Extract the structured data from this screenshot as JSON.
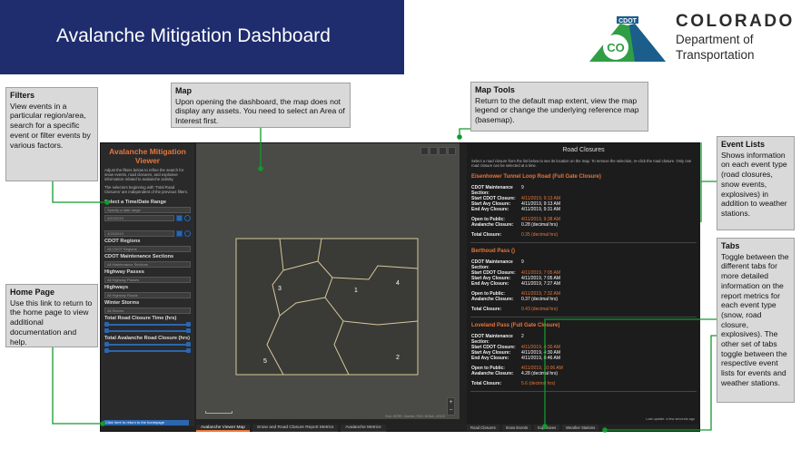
{
  "banner_title": "Avalanche Mitigation Dashboard",
  "logo": {
    "badge": "CDOT",
    "monogram": "CO",
    "state": "COLORADO",
    "dept_line1": "Department of",
    "dept_line2": "Transportation"
  },
  "callouts": {
    "filters": {
      "title": "Filters",
      "body": "View events in a particular region/area, search for a specific event or filter events by various factors."
    },
    "map": {
      "title": "Map",
      "body": "Upon opening the dashboard, the map does not display any assets. You need to select an Area of Interest first."
    },
    "map_tools": {
      "title": "Map Tools",
      "body": "Return to the default map extent, view the map legend or change the underlying reference map (basemap)."
    },
    "event_lists": {
      "title": "Event Lists",
      "body": "Shows information on each event type (road closures, snow events, explosives) in addition to weather stations."
    },
    "tabs": {
      "title": "Tabs",
      "body": "Toggle between the different tabs for more detailed information on the report metrics for each event type (snow, road closure, explosives). The other set of tabs toggle between the respective event lists for events and weather stations."
    },
    "home_page": {
      "title": "Home Page",
      "body": "Use this link to return to the home page to view additional documentation and help."
    }
  },
  "sidebar": {
    "title": "Avalanche Mitigation Viewer",
    "intro": "Adjust the filters below to refine the search for snow events, road closures, and explosive information related to avalanche activity.",
    "note": "The selectors beginning with 'Total Road Closures' are independent of the previous filters.",
    "time_head": "Select a Time/Date Range",
    "time_select": "Specify a date range",
    "date_start": "4/10/2019",
    "date_end": "4/23/2019",
    "regions_head": "CDOT Regions",
    "regions_select": "All CDOT Regions",
    "maint_head": "CDOT Maintenance Sections",
    "maint_select": "All Maintenance Sections",
    "passes_head": "Highway Passes",
    "passes_select": "All Highway Passes",
    "highways_head": "Highways",
    "highways_select": "All Highway Roads",
    "storms_head": "Winter Storms",
    "storms_select": "All Storms",
    "closure_time_head": "Total Road Closure Time (hrs)",
    "closure_avalanche_head": "Total Avalanche Road Closure (hrs)",
    "home_link": "Click here to return to the homepage"
  },
  "map": {
    "region_labels": [
      "1",
      "2",
      "3",
      "4",
      "5"
    ],
    "attribution": "Esri, HERE, Garmin, FAO, NOAA, USGS"
  },
  "panel": {
    "title": "Road Closures",
    "instructions": "Select a road closure from the list below to see its location on the map. To remove the selection, re-click the road closure. Only one road closure can be selected at a time.",
    "events": [
      {
        "name": "Eisenhower Tunnel Loop Road (Full Gate Closure)",
        "section": "9",
        "start_cdot": "4/11/2019, 9:13 AM",
        "start_avy": "4/11/2019, 9:13 AM",
        "end_avy": "4/11/2019, 9:31 AM",
        "open": "4/11/2019, 9:38 AM",
        "avalanche": "0.28 (decimal hrs)",
        "total": "0.35 (decimal hrs)"
      },
      {
        "name": "Berthoud Pass ()",
        "section": "9",
        "start_cdot": "4/11/2019, 7:05 AM",
        "start_avy": "4/11/2019, 7:05 AM",
        "end_avy": "4/11/2019, 7:27 AM",
        "open": "4/11/2019, 7:32 AM",
        "avalanche": "0.37 (decimal hrs)",
        "total": "0.43 (decimal hrs)"
      },
      {
        "name": "Loveland Pass (Full Gate Closure)",
        "section": "2",
        "start_cdot": "4/11/2019, 4:30 AM",
        "start_avy": "4/11/2019, 4:30 AM",
        "end_avy": "4/11/2019, 8:46 AM",
        "open": "4/11/2019, 10:06 AM",
        "avalanche": "4.28 (decimal hrs)",
        "total": "5.6 (decimal hrs)"
      }
    ],
    "labels": {
      "section": "CDOT Maintenance Section:",
      "start_cdot": "Start CDOT Closure:",
      "start_avy": "Start Avy Closure:",
      "end_avy": "End Avy Closure:",
      "open": "Open to Public:",
      "avalanche": "Avalanche Closure:",
      "total": "Total Closure:"
    },
    "updated": "Last update: a few seconds ago"
  },
  "tabs": {
    "left": [
      "Avalanche Viewer Map",
      "Snow and Road Closure Report Metrics",
      "Avalanche Metrics"
    ],
    "right": [
      "Road Closures",
      "Snow Events",
      "Explosives",
      "Weather Stations"
    ]
  },
  "colors": {
    "banner": "#1f2c6e",
    "callout_line": "#119a2e",
    "accent": "#e8753a",
    "link": "#2b66b0"
  }
}
